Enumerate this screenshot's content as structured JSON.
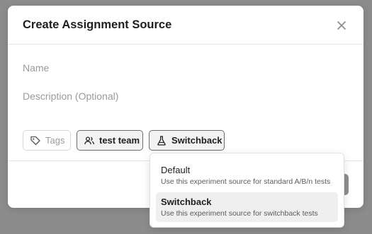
{
  "modal": {
    "title": "Create Assignment Source",
    "name_placeholder": "Name",
    "description_placeholder": "Description (Optional)",
    "chips": {
      "tags_label": "Tags",
      "team_label": "test team",
      "type_label": "Switchback"
    }
  },
  "dropdown": {
    "options": [
      {
        "title": "Default",
        "description": "Use this experiment source for standard A/B/n tests",
        "selected": false
      },
      {
        "title": "Switchback",
        "description": "Use this experiment source for switchback tests",
        "selected": true
      }
    ]
  },
  "colors": {
    "backdrop": "#8c8c8c",
    "selected_option_bg": "#efefef",
    "chip_border_active": "#6b6b6b"
  },
  "icons": {
    "close": "close-icon",
    "tags": "tag-icon",
    "team": "users-icon",
    "type": "flask-icon"
  }
}
